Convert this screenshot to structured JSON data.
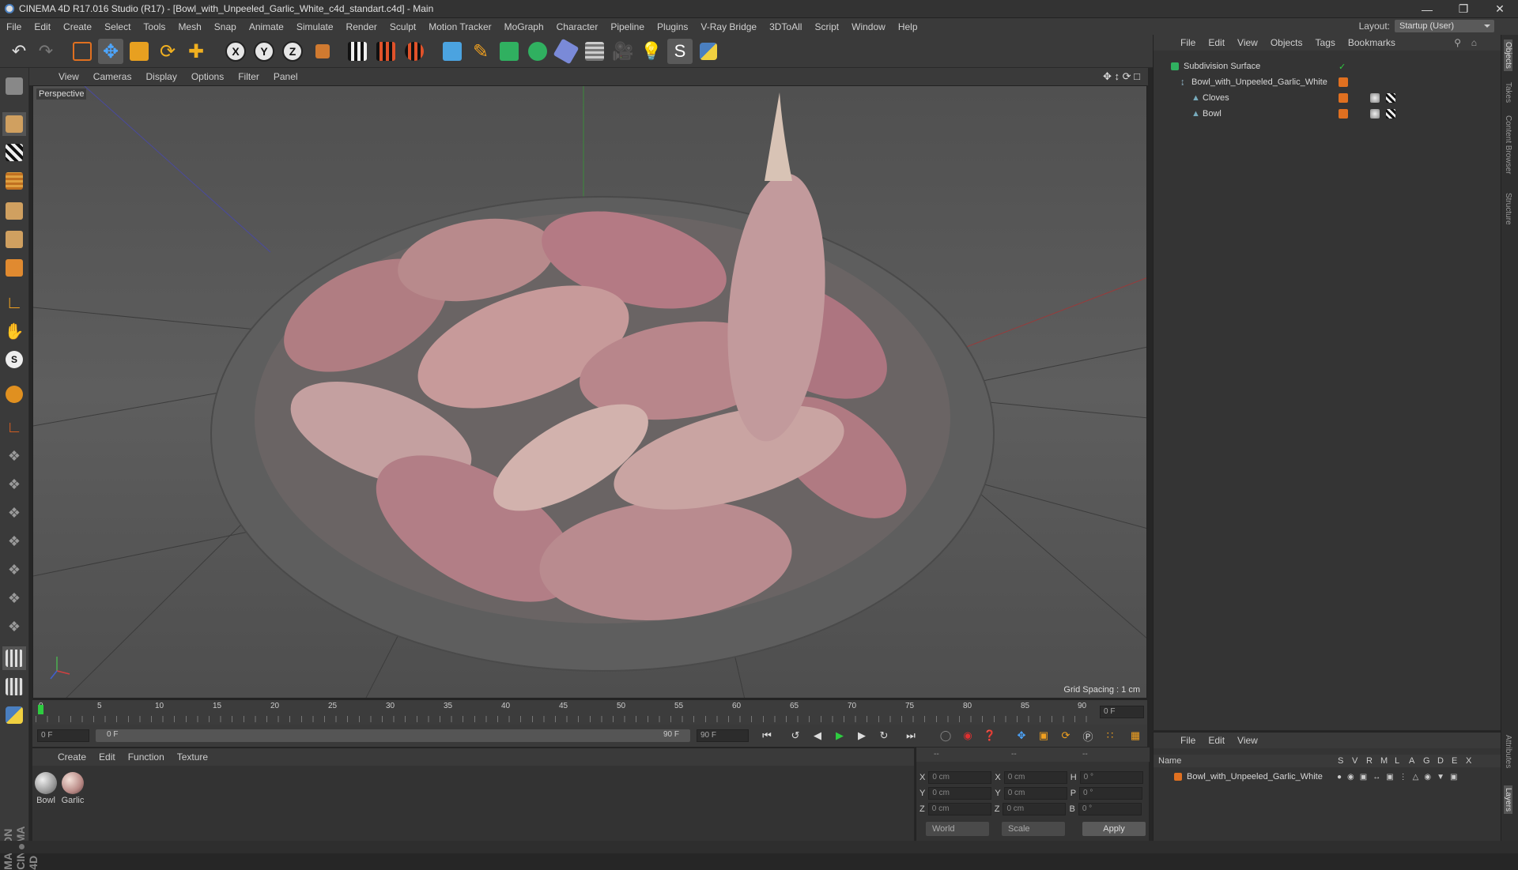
{
  "window": {
    "title": "CINEMA 4D R17.016 Studio (R17) - [Bowl_with_Unpeeled_Garlic_White_c4d_standart.c4d] - Main"
  },
  "menu": [
    "File",
    "Edit",
    "Create",
    "Select",
    "Tools",
    "Mesh",
    "Snap",
    "Animate",
    "Simulate",
    "Render",
    "Sculpt",
    "Motion Tracker",
    "MoGraph",
    "Character",
    "Pipeline",
    "Plugins",
    "V-Ray Bridge",
    "3DToAll",
    "Script",
    "Window",
    "Help"
  ],
  "layout": {
    "label": "Layout:",
    "value": "Startup (User)"
  },
  "viewport": {
    "menu": [
      "View",
      "Cameras",
      "Display",
      "Options",
      "Filter",
      "Panel"
    ],
    "label": "Perspective",
    "grid_spacing": "Grid Spacing : 1 cm"
  },
  "timeline": {
    "ticks": [
      "0",
      "5",
      "10",
      "15",
      "20",
      "25",
      "30",
      "35",
      "40",
      "45",
      "50",
      "55",
      "60",
      "65",
      "70",
      "75",
      "80",
      "85",
      "90"
    ],
    "frame_display": "0 F",
    "start": "0 F",
    "range_start": "0 F",
    "range_end": "90 F",
    "end": "90 F"
  },
  "material_panel": {
    "menu": [
      "Create",
      "Edit",
      "Function",
      "Texture"
    ],
    "materials": [
      {
        "name": "Bowl",
        "color": "#b8b8b8"
      },
      {
        "name": "Garlic",
        "color": "#c9a89e"
      }
    ]
  },
  "coords": {
    "header": [
      "--",
      "--",
      "--"
    ],
    "rows": [
      {
        "a": "X",
        "av": "0 cm",
        "b": "X",
        "bv": "0 cm",
        "c": "H",
        "cv": "0 °"
      },
      {
        "a": "Y",
        "av": "0 cm",
        "b": "Y",
        "bv": "0 cm",
        "c": "P",
        "cv": "0 °"
      },
      {
        "a": "Z",
        "av": "0 cm",
        "b": "Z",
        "bv": "0 cm",
        "c": "B",
        "cv": "0 °"
      }
    ],
    "world": "World",
    "scale": "Scale",
    "apply": "Apply"
  },
  "objects": {
    "menu": [
      "File",
      "Edit",
      "View",
      "Objects",
      "Tags",
      "Bookmarks"
    ],
    "items": [
      {
        "name": "Subdivision Surface"
      },
      {
        "name": "Bowl_with_Unpeeled_Garlic_White"
      },
      {
        "name": "Cloves"
      },
      {
        "name": "Bowl"
      }
    ]
  },
  "layers": {
    "menu": [
      "File",
      "Edit",
      "View"
    ],
    "columns": [
      "Name",
      "S",
      "V",
      "R",
      "M",
      "L",
      "A",
      "G",
      "D",
      "E",
      "X"
    ],
    "row": "Bowl_with_Unpeeled_Garlic_White"
  },
  "right_tabs": [
    "Objects",
    "Takes",
    "Content Browser",
    "Structure",
    "Attributes",
    "Layers"
  ],
  "brand": "MAXON CINEMA 4D",
  "colors": {
    "accent_orange": "#e07020",
    "green_marker": "#2ecc40"
  }
}
